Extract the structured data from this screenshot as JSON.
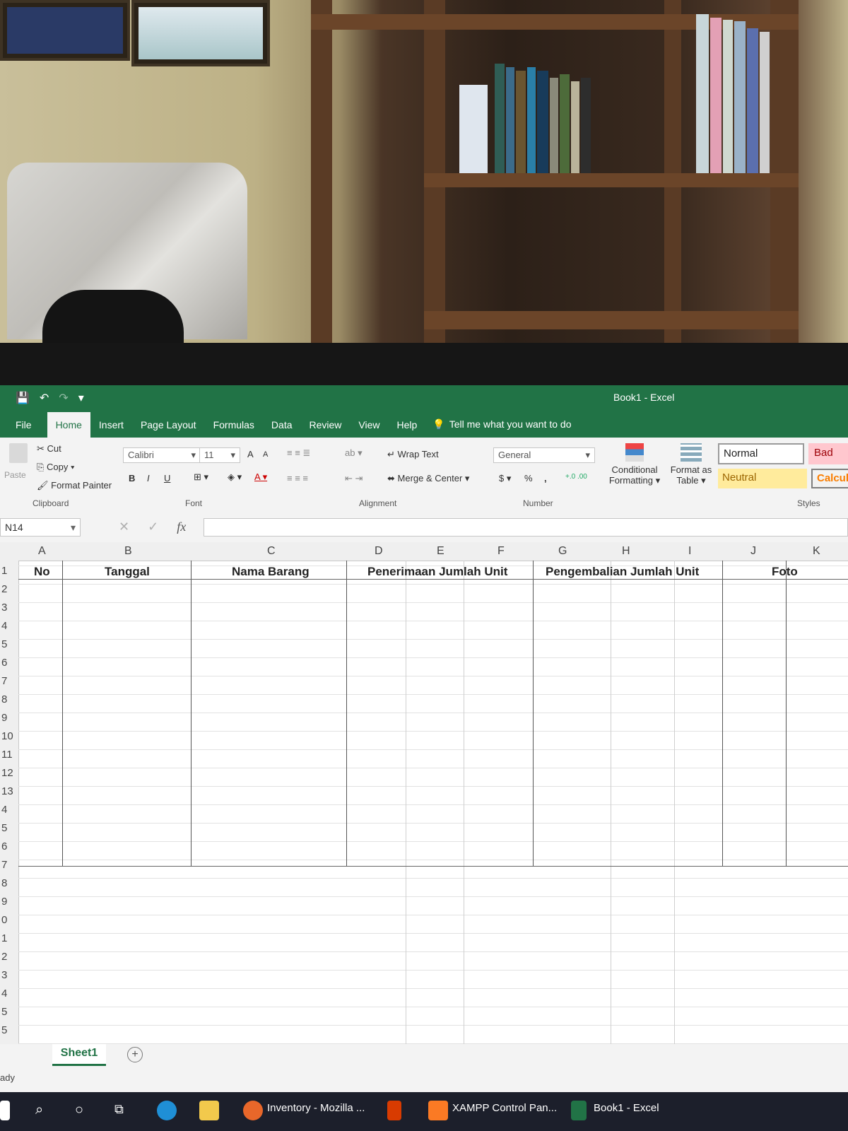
{
  "window": {
    "title": "Book1  -  Excel"
  },
  "qat": {
    "save": "💾",
    "undo": "↶",
    "redo": "↷",
    "customize": "▾"
  },
  "tabs": [
    "File",
    "Home",
    "Insert",
    "Page Layout",
    "Formulas",
    "Data",
    "Review",
    "View",
    "Help"
  ],
  "tell_me": "Tell me what you want to do",
  "ribbon": {
    "clipboard": {
      "paste": "Paste",
      "cut": "Cut",
      "copy": "Copy",
      "format_painter": "Format Painter",
      "label": "Clipboard"
    },
    "font": {
      "name": "Calibri",
      "size": "11",
      "bold": "B",
      "italic": "I",
      "underline": "U",
      "label": "Font"
    },
    "alignment": {
      "wrap_text": "Wrap Text",
      "merge_center": "Merge & Center",
      "label": "Alignment"
    },
    "number": {
      "format": "General",
      "currency": "$",
      "percent": "%",
      "comma": ",",
      "label": "Number"
    },
    "styles": {
      "conditional_formatting_1": "Conditional",
      "conditional_formatting_2": "Formatting",
      "format_as_table_1": "Format as",
      "format_as_table_2": "Table",
      "normal": "Normal",
      "bad": "Bad",
      "neutral": "Neutral",
      "calculation": "Calcul",
      "label": "Styles"
    }
  },
  "formula_bar": {
    "name_box": "N14",
    "fx": "fx",
    "cancel": "✕",
    "enter": "✓",
    "value": ""
  },
  "columns": [
    "A",
    "B",
    "C",
    "D",
    "E",
    "F",
    "G",
    "H",
    "I",
    "J",
    "K"
  ],
  "rows": [
    "1",
    "2",
    "3",
    "4",
    "5",
    "6",
    "7",
    "8",
    "9",
    "10",
    "11",
    "12",
    "13",
    "4",
    "5",
    "6",
    "7",
    "8",
    "9",
    "0",
    "1",
    "2",
    "3",
    "4",
    "5",
    "5"
  ],
  "table_headers": {
    "no": "No",
    "tanggal": "Tanggal",
    "nama_barang": "Nama Barang",
    "penerimaan": "Penerimaan Jumlah Unit",
    "pengembalian": "Pengembalian Jumlah Unit",
    "foto": "Foto"
  },
  "sheet": {
    "tab": "Sheet1",
    "add": "+",
    "status": "ady"
  },
  "taskbar": {
    "firefox": "Inventory - Mozilla ...",
    "xampp": "XAMPP Control Pan...",
    "excel": "Book1 - Excel"
  },
  "colors": {
    "excel_green": "#217346",
    "taskbar": "#1c1f2b"
  }
}
